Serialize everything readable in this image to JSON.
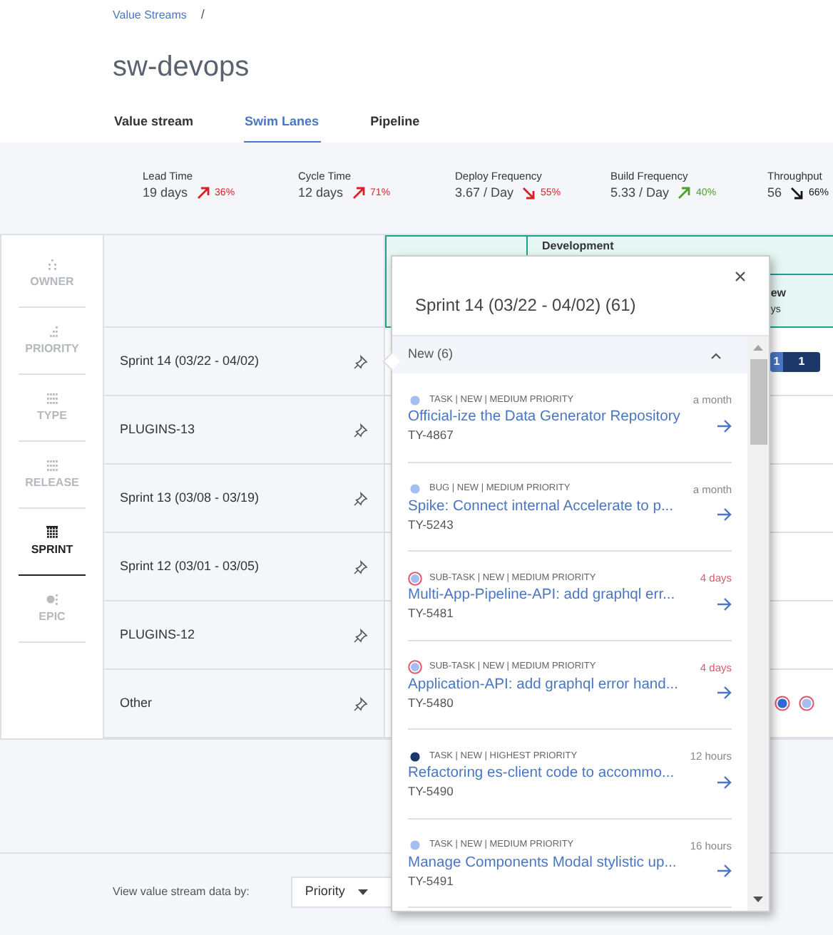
{
  "breadcrumb": {
    "link": "Value Streams",
    "separator": "/"
  },
  "title": "sw-devops",
  "tabs": [
    {
      "label": "Value stream",
      "selected": false
    },
    {
      "label": "Swim Lanes",
      "selected": true
    },
    {
      "label": "Pipeline",
      "selected": false
    }
  ],
  "metrics": [
    {
      "label": "Lead Time",
      "value": "19 days",
      "change": "36%",
      "rising": true,
      "color": "#da1e28"
    },
    {
      "label": "Cycle Time",
      "value": "12 days",
      "change": "71%",
      "rising": true,
      "color": "#da1e28"
    },
    {
      "label": "Deploy Frequency",
      "value": "3.67 / Day",
      "change": "55%",
      "rising": false,
      "color": "#da1e28"
    },
    {
      "label": "Build Frequency",
      "value": "5.33 / Day",
      "change": "40%",
      "rising": true,
      "color": "#4ea028"
    },
    {
      "label": "Throughput",
      "value": "56",
      "change": "66%",
      "rising": false,
      "color": "#161616"
    }
  ],
  "group_by": [
    {
      "label": "OWNER",
      "selected": false
    },
    {
      "label": "PRIORITY",
      "selected": false
    },
    {
      "label": "TYPE",
      "selected": false
    },
    {
      "label": "RELEASE",
      "selected": false
    },
    {
      "label": "SPRINT",
      "selected": true
    },
    {
      "label": "EPIC",
      "selected": false
    }
  ],
  "lanes": [
    {
      "name": "Sprint 14 (03/22 - 04/02)"
    },
    {
      "name": "PLUGINS-13"
    },
    {
      "name": "Sprint 13 (03/08 - 03/19)"
    },
    {
      "name": "Sprint 12 (03/01 - 03/05)"
    },
    {
      "name": "PLUGINS-12"
    },
    {
      "name": "Other"
    }
  ],
  "board": {
    "group": "Development",
    "stage_name": "ew",
    "stage_time": "ys",
    "lane_badges": [
      "1",
      "1"
    ]
  },
  "popover": {
    "title": "Sprint 14 (03/22 - 04/02) (61)",
    "section": {
      "label": "New (6)",
      "expanded": true
    },
    "items": [
      {
        "kind": "dot",
        "color": "#a6bdf0",
        "meta": "TASK | NEW | MEDIUM PRIORITY",
        "age": "a month",
        "overdue": false,
        "title": "Official-ize the Data Generator Repository",
        "id": "TY-4867"
      },
      {
        "kind": "dot",
        "color": "#a6bdf0",
        "meta": "BUG | NEW | MEDIUM PRIORITY",
        "age": "a month",
        "overdue": false,
        "title": "Spike: Connect internal Accelerate to p...",
        "id": "TY-5243"
      },
      {
        "kind": "ringed",
        "color": "#a6bdf0",
        "meta": "SUB-TASK | NEW | MEDIUM PRIORITY",
        "age": "4 days",
        "overdue": true,
        "title": "Multi-App-Pipeline-API: add graphql err...",
        "id": "TY-5481"
      },
      {
        "kind": "ringed",
        "color": "#a6bdf0",
        "meta": "SUB-TASK | NEW | MEDIUM PRIORITY",
        "age": "4 days",
        "overdue": true,
        "title": "Application-API: add graphql error hand...",
        "id": "TY-5480"
      },
      {
        "kind": "dot",
        "color": "#1c3868",
        "meta": "TASK | NEW | HIGHEST PRIORITY",
        "age": "12 hours",
        "overdue": false,
        "title": "Refactoring es-client code to accommo...",
        "id": "TY-5490"
      },
      {
        "kind": "dot",
        "color": "#a6bdf0",
        "meta": "TASK | NEW | MEDIUM PRIORITY",
        "age": "16 hours",
        "overdue": false,
        "title": "Manage Components Modal stylistic up...",
        "id": "TY-5491"
      }
    ]
  },
  "footer": {
    "label": "View value stream data by:",
    "dropdown": "Priority"
  }
}
